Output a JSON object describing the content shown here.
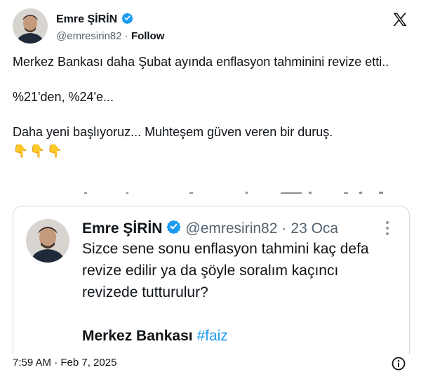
{
  "author": {
    "name": "Emre ŞİRİN",
    "handle": "@emresirin82",
    "separator": "·",
    "follow_label": "Follow",
    "verified": true
  },
  "tweet": {
    "lines": [
      "Merkez Bankası daha Şubat ayında enflasyon tahminini revize etti..",
      "%21'den, %24'e...",
      "Daha yeni başlıyoruz... Muhteşem güven veren bir duruş."
    ],
    "emoji": [
      "👇",
      "👇",
      "👇"
    ]
  },
  "quoted_tweet": {
    "name": "Emre ŞİRİN",
    "handle": "@emresirin82",
    "separator": "·",
    "date": "23 Oca",
    "text": "Sizce sene sonu enflasyon tahmini kaç defa revize edilir ya da şöyle soralım kaçıncı revizede tutturulur?",
    "footer_text": "Merkez Bankası",
    "hashtag": "#faiz"
  },
  "footer": {
    "timestamp": "7:59 AM · Feb 7, 2025"
  },
  "colors": {
    "text": "#0f1419",
    "secondary": "#536471",
    "link": "#1d9bf0",
    "verified": "#1d9bf0",
    "border": "#cfd9de"
  },
  "icons": [
    "x-logo-icon",
    "verified-badge-icon",
    "more-options-icon",
    "info-icon"
  ]
}
